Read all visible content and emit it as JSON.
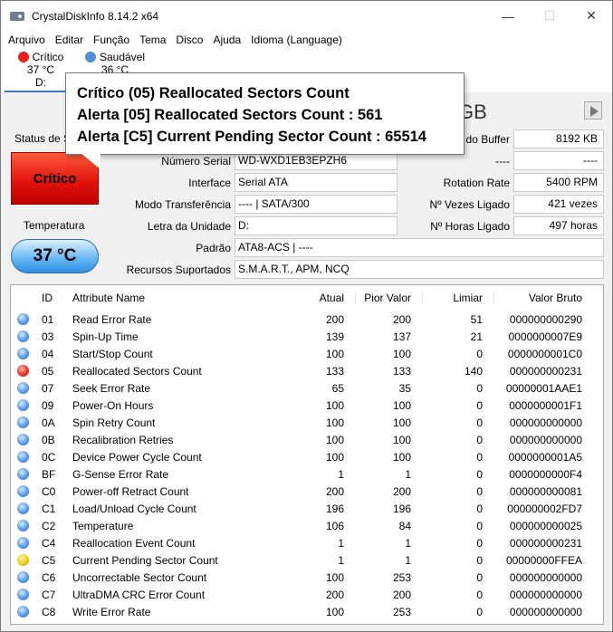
{
  "window": {
    "title": "CrystalDiskInfo 8.14.2 x64",
    "minimize_icon": "—",
    "maximize_icon": "☐",
    "close_icon": "✕"
  },
  "menu": [
    "Arquivo",
    "Editar",
    "Função",
    "Tema",
    "Disco",
    "Ajuda",
    "Idioma (Language)"
  ],
  "drives": [
    {
      "status": "Crítico",
      "temp": "37 °C",
      "letter": "D:",
      "color": "#e8201a"
    },
    {
      "status": "Saudável",
      "temp": "36 °C",
      "letter": "",
      "color": "#4f8fe0"
    }
  ],
  "model_partial": "GB",
  "tooltip": [
    "Crítico (05) Reallocated Sectors Count",
    "Alerta [05] Reallocated Sectors Count : 561",
    "Alerta [C5] Current Pending Sector Count : 65514"
  ],
  "status": {
    "label": "Status de S",
    "value": "Crítico",
    "temp_label": "Temperatura",
    "temp_value": "37 °C"
  },
  "info_left": [
    {
      "label": "Número Serial",
      "value": "WD-WXD1EB3EPZH6"
    },
    {
      "label": "Interface",
      "value": "Serial ATA"
    },
    {
      "label": "Modo Transferência",
      "value": "---- | SATA/300"
    },
    {
      "label": "Letra da Unidade",
      "value": "D:"
    }
  ],
  "info_right": [
    {
      "label": "do Buffer",
      "value": "8192 KB"
    },
    {
      "label": "----",
      "value": "----"
    },
    {
      "label": "Rotation Rate",
      "value": "5400 RPM"
    },
    {
      "label": "Nº Vezes Ligado",
      "value": "421 vezes"
    },
    {
      "label": "Nº Horas Ligado",
      "value": "497 horas"
    }
  ],
  "padrao": {
    "label": "Padrão",
    "value": "ATA8-ACS | ----"
  },
  "recursos": {
    "label": "Recursos Suportados",
    "value": "S.M.A.R.T., APM, NCQ"
  },
  "table": {
    "headers": [
      "ID",
      "Attribute Name",
      "Atual",
      "Pior Valor",
      "Limiar",
      "Valor Bruto"
    ],
    "rows": [
      {
        "s": "good",
        "id": "01",
        "name": "Read Error Rate",
        "cur": "200",
        "worst": "200",
        "thr": "51",
        "raw": "000000000290"
      },
      {
        "s": "good",
        "id": "03",
        "name": "Spin-Up Time",
        "cur": "139",
        "worst": "137",
        "thr": "21",
        "raw": "0000000007E9"
      },
      {
        "s": "good",
        "id": "04",
        "name": "Start/Stop Count",
        "cur": "100",
        "worst": "100",
        "thr": "0",
        "raw": "0000000001C0"
      },
      {
        "s": "bad",
        "id": "05",
        "name": "Reallocated Sectors Count",
        "cur": "133",
        "worst": "133",
        "thr": "140",
        "raw": "000000000231"
      },
      {
        "s": "good",
        "id": "07",
        "name": "Seek Error Rate",
        "cur": "65",
        "worst": "35",
        "thr": "0",
        "raw": "00000001AAE1"
      },
      {
        "s": "good",
        "id": "09",
        "name": "Power-On Hours",
        "cur": "100",
        "worst": "100",
        "thr": "0",
        "raw": "0000000001F1"
      },
      {
        "s": "good",
        "id": "0A",
        "name": "Spin Retry Count",
        "cur": "100",
        "worst": "100",
        "thr": "0",
        "raw": "000000000000"
      },
      {
        "s": "good",
        "id": "0B",
        "name": "Recalibration Retries",
        "cur": "100",
        "worst": "100",
        "thr": "0",
        "raw": "000000000000"
      },
      {
        "s": "good",
        "id": "0C",
        "name": "Device Power Cycle Count",
        "cur": "100",
        "worst": "100",
        "thr": "0",
        "raw": "0000000001A5"
      },
      {
        "s": "good",
        "id": "BF",
        "name": "G-Sense Error Rate",
        "cur": "1",
        "worst": "1",
        "thr": "0",
        "raw": "0000000000F4"
      },
      {
        "s": "good",
        "id": "C0",
        "name": "Power-off Retract Count",
        "cur": "200",
        "worst": "200",
        "thr": "0",
        "raw": "000000000081"
      },
      {
        "s": "good",
        "id": "C1",
        "name": "Load/Unload Cycle Count",
        "cur": "196",
        "worst": "196",
        "thr": "0",
        "raw": "000000002FD7"
      },
      {
        "s": "good",
        "id": "C2",
        "name": "Temperature",
        "cur": "106",
        "worst": "84",
        "thr": "0",
        "raw": "000000000025"
      },
      {
        "s": "good",
        "id": "C4",
        "name": "Reallocation Event Count",
        "cur": "1",
        "worst": "1",
        "thr": "0",
        "raw": "000000000231"
      },
      {
        "s": "warn",
        "id": "C5",
        "name": "Current Pending Sector Count",
        "cur": "1",
        "worst": "1",
        "thr": "0",
        "raw": "00000000FFEA"
      },
      {
        "s": "good",
        "id": "C6",
        "name": "Uncorrectable Sector Count",
        "cur": "100",
        "worst": "253",
        "thr": "0",
        "raw": "000000000000"
      },
      {
        "s": "good",
        "id": "C7",
        "name": "UltraDMA CRC Error Count",
        "cur": "200",
        "worst": "200",
        "thr": "0",
        "raw": "000000000000"
      },
      {
        "s": "good",
        "id": "C8",
        "name": "Write Error Rate",
        "cur": "100",
        "worst": "253",
        "thr": "0",
        "raw": "000000000000"
      }
    ]
  }
}
